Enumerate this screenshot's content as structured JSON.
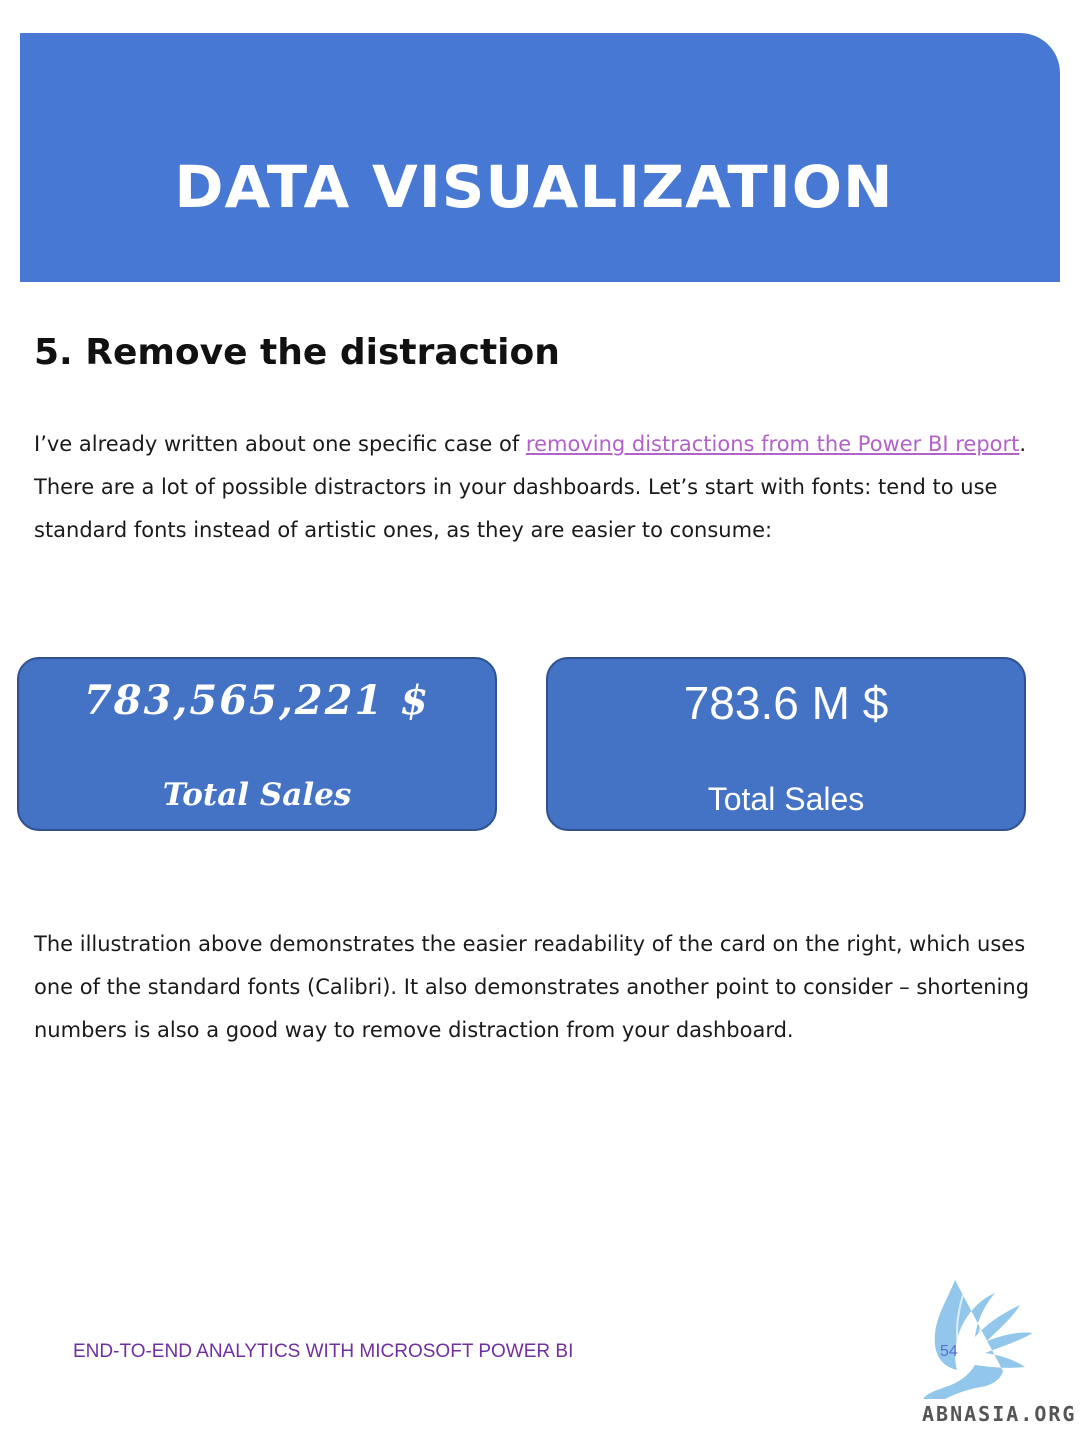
{
  "banner": {
    "title": "DATA VISUALIZATION"
  },
  "section": {
    "heading": "5. Remove the distraction"
  },
  "paragraph1": {
    "before_link": "I’ve already written about one specific case of ",
    "link_text": "removing distractions from the Power BI report",
    "after_link": ". There are a lot of possible distractors in your dashboards. Let’s start with fonts: tend to use standard fonts instead of artistic ones, as they are easier to consume:"
  },
  "cards": {
    "left": {
      "value": "783,565,221 $",
      "label": "Total Sales"
    },
    "right": {
      "value": "783.6 M $",
      "label": "Total Sales"
    }
  },
  "paragraph2": {
    "text": "The illustration above demonstrates the easier readability of the card on the right, which uses one of the standard fonts (Calibri). It also demonstrates another point to consider – shortening numbers is also a good way to remove distraction from your dashboard."
  },
  "footer": {
    "text": "END-TO-END ANALYTICS WITH MICROSOFT POWER BI",
    "page_number": "54",
    "brand": "ABNASIA.ORG"
  },
  "colors": {
    "banner": "#4779d4",
    "card": "#4472c4",
    "link": "#b262c9",
    "footer_text": "#7030a0"
  },
  "icons": {
    "logo": "winged-griffin-logo"
  }
}
